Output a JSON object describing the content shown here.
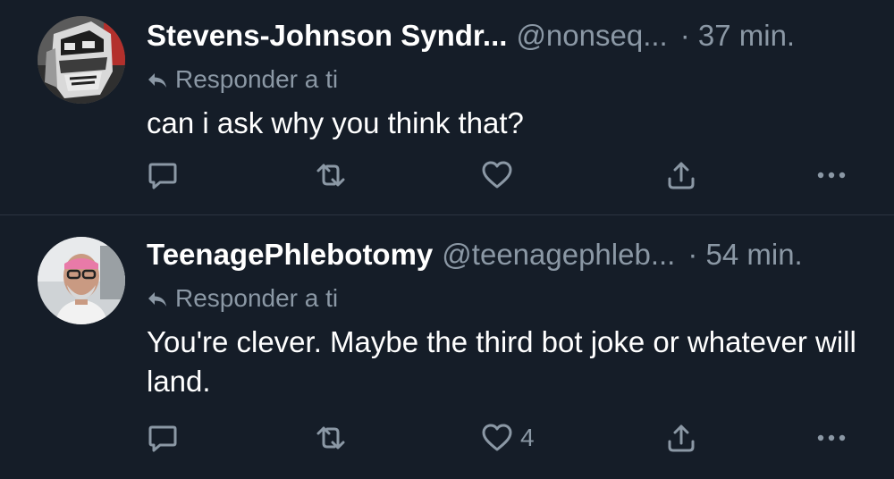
{
  "tweets": [
    {
      "display_name": "Stevens-Johnson Syndr...",
      "handle": "@nonseq...",
      "time": "· 37 min.",
      "reply_context": "Responder a ti",
      "text": "can i ask why you think that?",
      "like_count": ""
    },
    {
      "display_name": "TeenagePhlebotomy",
      "handle": "@teenagephleb...",
      "time": "· 54 min.",
      "reply_context": "Responder a ti",
      "text": "You're clever. Maybe the third bot joke or whatever will land.",
      "like_count": "4"
    }
  ],
  "icons": {
    "reply": "reply-icon",
    "retweet": "retweet-icon",
    "like": "heart-icon",
    "share": "share-icon",
    "more": "more-icon",
    "reply_context": "reply-arrow-icon"
  },
  "colors": {
    "background": "#151d28",
    "primary_text": "#ffffff",
    "secondary_text": "#8b98a5",
    "divider": "#2b3440"
  }
}
